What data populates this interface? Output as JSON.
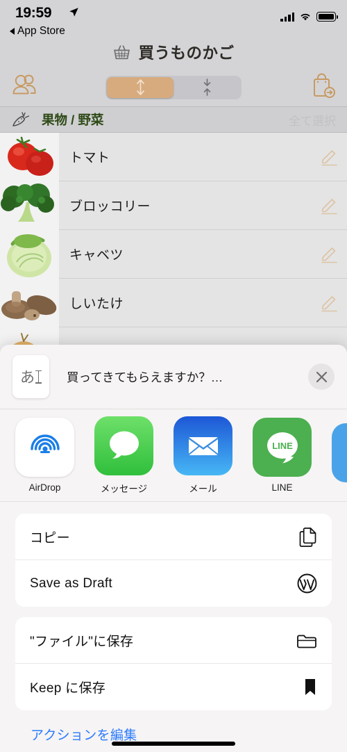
{
  "status_bar": {
    "time": "19:59",
    "back_label": "App Store",
    "location_icon": "location-arrow-icon",
    "signal_icon": "cellular-signal-icon",
    "wifi_icon": "wifi-icon",
    "battery_icon": "battery-full-icon"
  },
  "app": {
    "title": "買うものかご",
    "title_icon": "shopping-basket-icon",
    "toolbar": {
      "people_icon": "people-icon",
      "bag_icon": "shopping-bag-arrow-icon",
      "segments": [
        {
          "name": "expand-all",
          "icon": "expand-vertical-icon",
          "selected": true
        },
        {
          "name": "collapse-all",
          "icon": "collapse-vertical-icon",
          "selected": false
        }
      ],
      "selected_color": "#d7ab7e"
    },
    "category": {
      "icon": "carrot-icon",
      "name": "果物 / 野菜",
      "select_all_label": "全て選択",
      "name_color": "#2e4a16"
    },
    "items": [
      {
        "label": "トマト",
        "thumb": "tomato-photo",
        "edit_icon": "pencil-icon"
      },
      {
        "label": "ブロッコリー",
        "thumb": "broccoli-photo",
        "edit_icon": "pencil-icon"
      },
      {
        "label": "キャベツ",
        "thumb": "cabbage-photo",
        "edit_icon": "pencil-icon"
      },
      {
        "label": "しいたけ",
        "thumb": "shiitake-photo",
        "edit_icon": "pencil-icon"
      }
    ]
  },
  "share_sheet": {
    "preview": {
      "doc_icon_char": "あ",
      "text": "買ってきてもらえますか？…",
      "close_icon": "close-icon"
    },
    "apps": [
      {
        "name": "AirDrop",
        "icon": "airdrop-icon"
      },
      {
        "name": "メッセージ",
        "icon": "messages-icon"
      },
      {
        "name": "メール",
        "icon": "mail-icon"
      },
      {
        "name": "LINE",
        "icon": "line-icon"
      },
      {
        "name": "",
        "icon": "skype-icon"
      }
    ],
    "actions": [
      {
        "label": "コピー",
        "icon": "copy-icon"
      },
      {
        "label": "Save as Draft",
        "icon": "wordpress-icon"
      },
      {
        "label": "\"ファイル\"に保存",
        "icon": "folder-icon"
      },
      {
        "label": "Keep に保存",
        "icon": "bookmark-icon"
      }
    ],
    "edit_actions_label": "アクションを編集",
    "edit_actions_color": "#2b7cff"
  }
}
